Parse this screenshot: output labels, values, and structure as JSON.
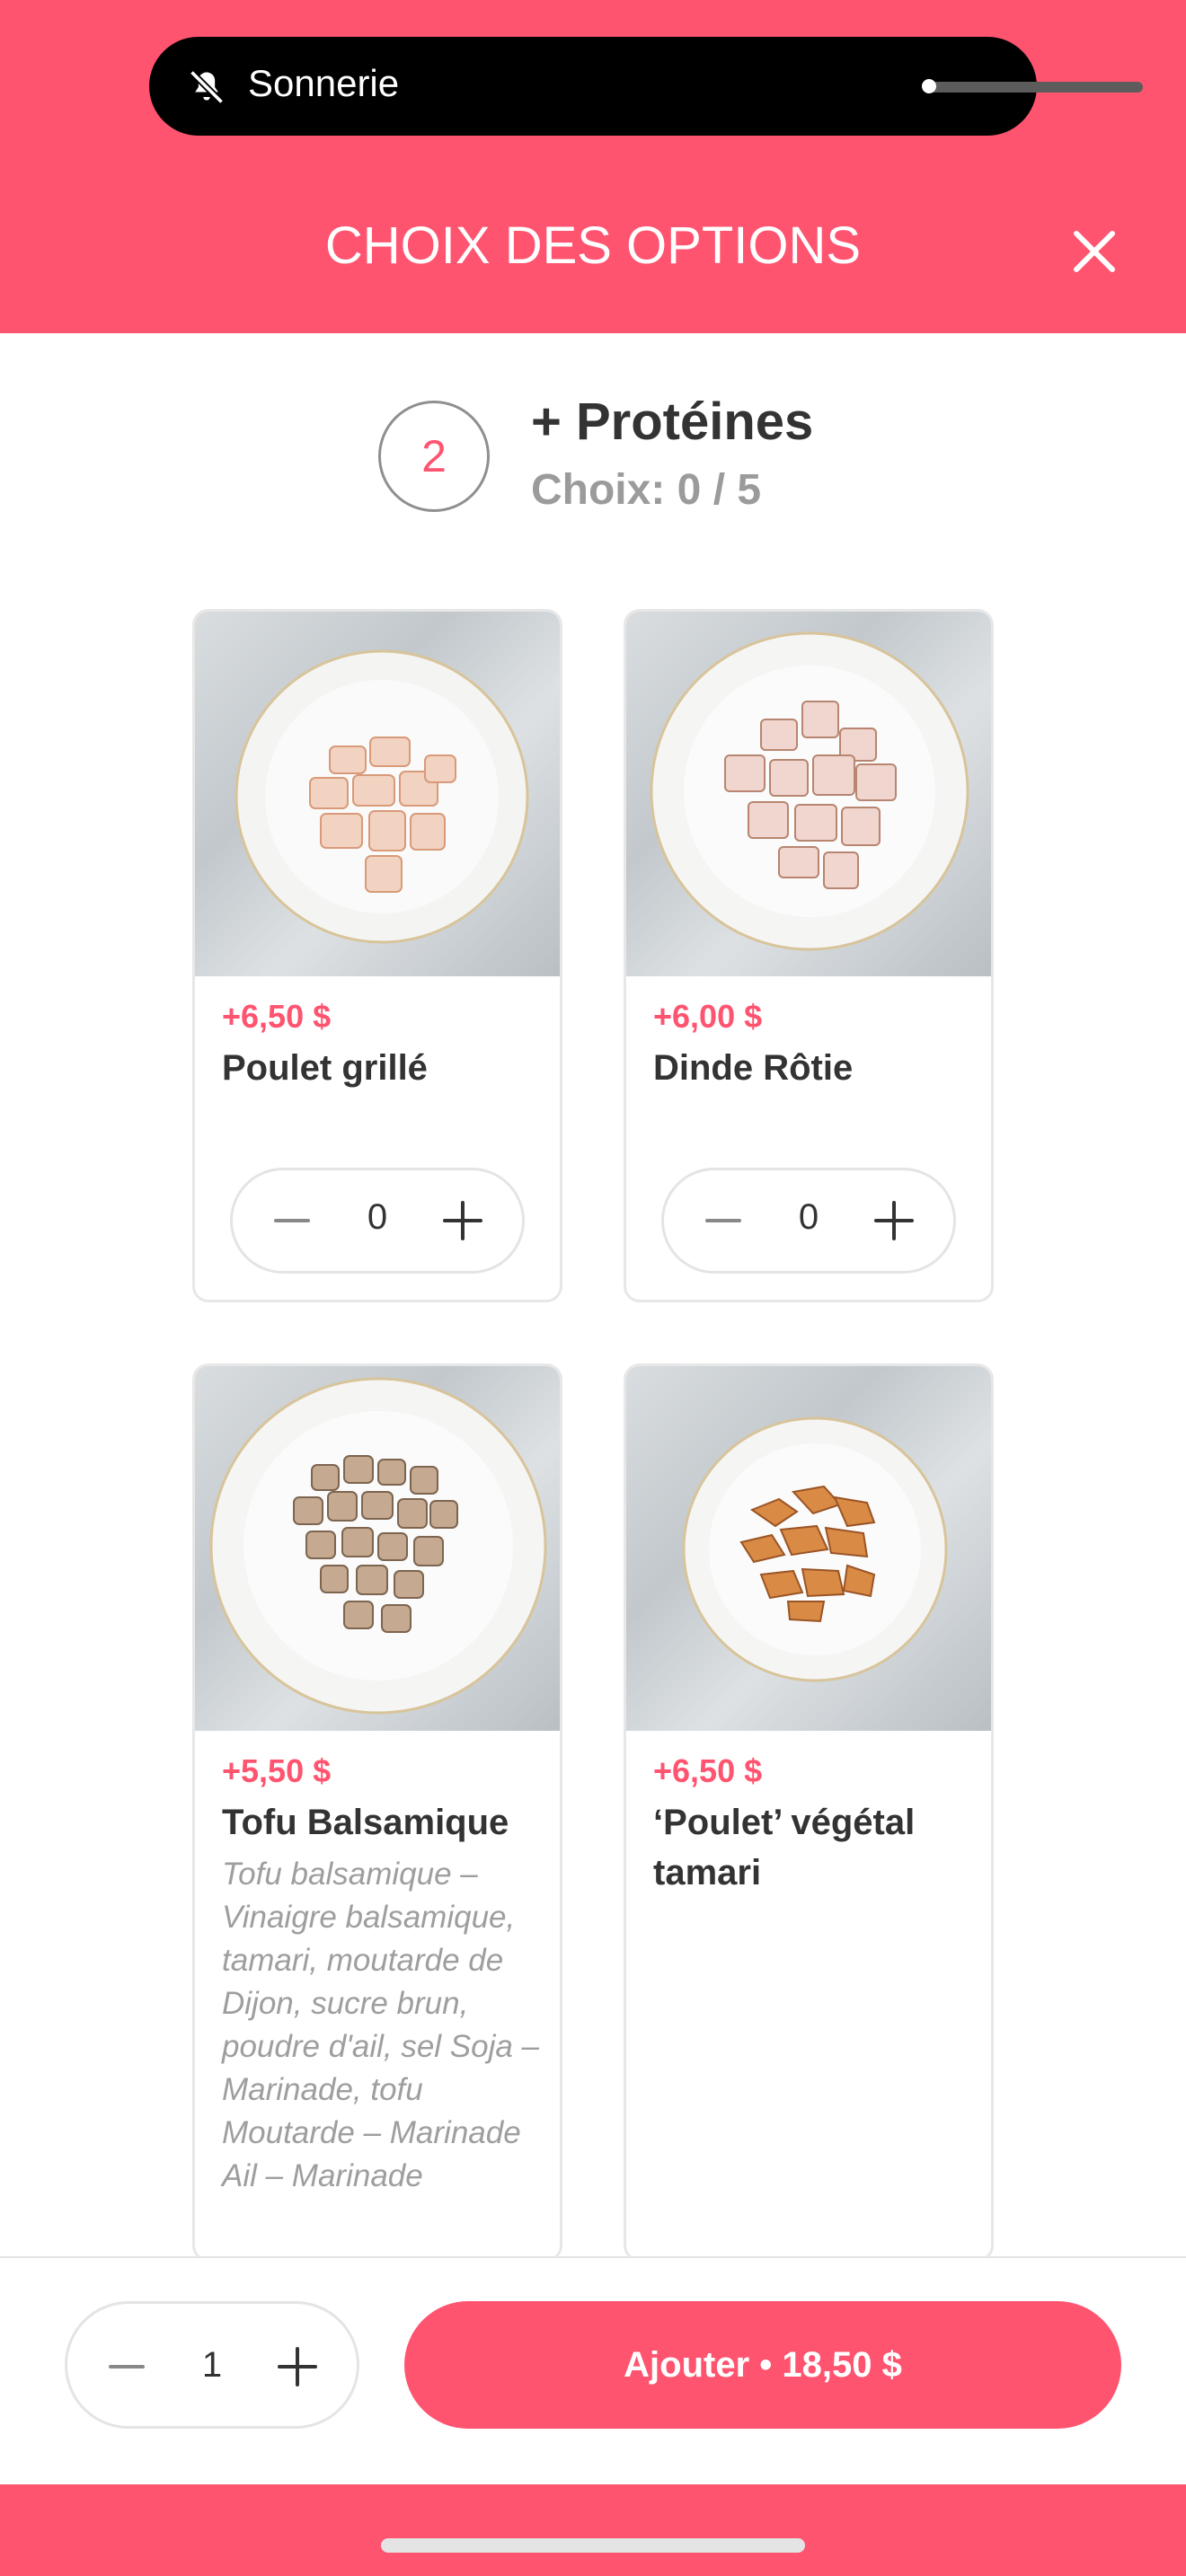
{
  "status_notification": {
    "label": "Sonnerie",
    "icon": "bell-slash-icon"
  },
  "header": {
    "title": "CHOIX DES OPTIONS",
    "close_icon": "close-icon"
  },
  "section": {
    "step": "2",
    "title": "+ Protéines",
    "subtitle": "Choix: 0 / 5"
  },
  "items": [
    {
      "price": "+6,50 $",
      "name": "Poulet grillé",
      "description": "",
      "quantity": "0"
    },
    {
      "price": "+6,00 $",
      "name": "Dinde Rôtie",
      "description": "",
      "quantity": "0"
    },
    {
      "price": "+5,50 $",
      "name": "Tofu Balsamique",
      "description": "Tofu balsamique – Vinaigre balsamique, tamari, moutarde de Dijon, sucre brun, poudre d'ail, sel Soja – Marinade, tofu Moutarde – Marinade Ail – Marinade",
      "quantity": ""
    },
    {
      "price": "+6,50 $",
      "name": "‘Poulet’ végétal tamari",
      "description": "",
      "quantity": ""
    }
  ],
  "footer": {
    "quantity": "1",
    "add_label": "Ajouter • 18,50 $"
  },
  "colors": {
    "accent": "#FF5470",
    "text": "#333333",
    "muted": "#9e9e9e"
  }
}
